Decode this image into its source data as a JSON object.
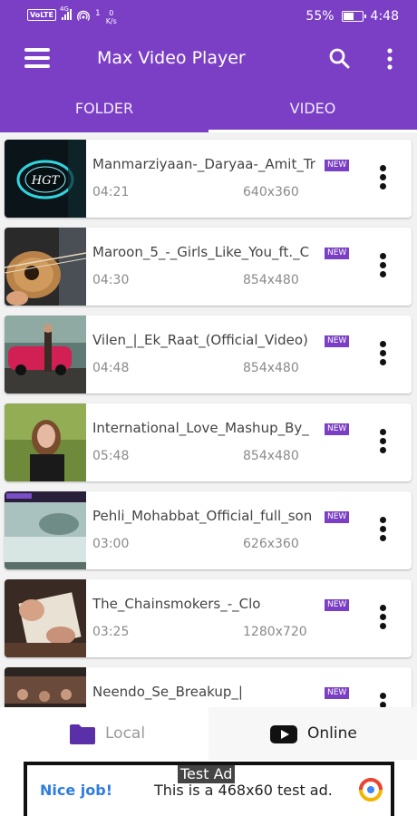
{
  "status_bar": {
    "volte": "VoLTE",
    "network": "4G",
    "data_count": "1",
    "speed_value": "0",
    "speed_unit": "K/s",
    "battery_percent": "55%",
    "battery_level": 0.55,
    "time": "4:48"
  },
  "app_bar": {
    "title": "Max Video Player",
    "color": "#7b3fc6"
  },
  "tabs": [
    {
      "label": "FOLDER",
      "active": false
    },
    {
      "label": "VIDEO",
      "active": true
    }
  ],
  "videos": [
    {
      "title": "Manmarziyaan-_Daryaa-_Amit_Tr",
      "duration": "04:21",
      "resolution": "640x360",
      "badge": "NEW",
      "thumb_text": "HGT"
    },
    {
      "title": "Maroon_5_-_Girls_Like_You_ft._C",
      "duration": "04:30",
      "resolution": "854x480",
      "badge": "NEW"
    },
    {
      "title": "Vilen_|_Ek_Raat_(Official_Video)",
      "duration": "04:48",
      "resolution": "854x480",
      "badge": "NEW"
    },
    {
      "title": "International_Love_Mashup_By_",
      "duration": "05:48",
      "resolution": "854x480",
      "badge": "NEW"
    },
    {
      "title": "Pehli_Mohabbat_Official_full_son",
      "duration": "03:00",
      "resolution": "626x360",
      "badge": "NEW"
    },
    {
      "title": "The_Chainsmokers_-_Clo",
      "duration": "03:25",
      "resolution": "1280x720",
      "badge": "NEW"
    },
    {
      "title": "Neendo_Se_Breakup_|",
      "duration": "",
      "resolution": "",
      "badge": "NEW"
    }
  ],
  "bottom_nav": {
    "local_label": "Local",
    "online_label": "Online"
  },
  "ad": {
    "label": "Test Ad",
    "nice": "Nice job!",
    "text": "This is a 468x60 test ad."
  },
  "icons": {
    "menu": "menu-icon",
    "search": "search-icon",
    "more": "more-vert-icon",
    "folder": "folder-icon",
    "youtube": "youtube-icon"
  }
}
